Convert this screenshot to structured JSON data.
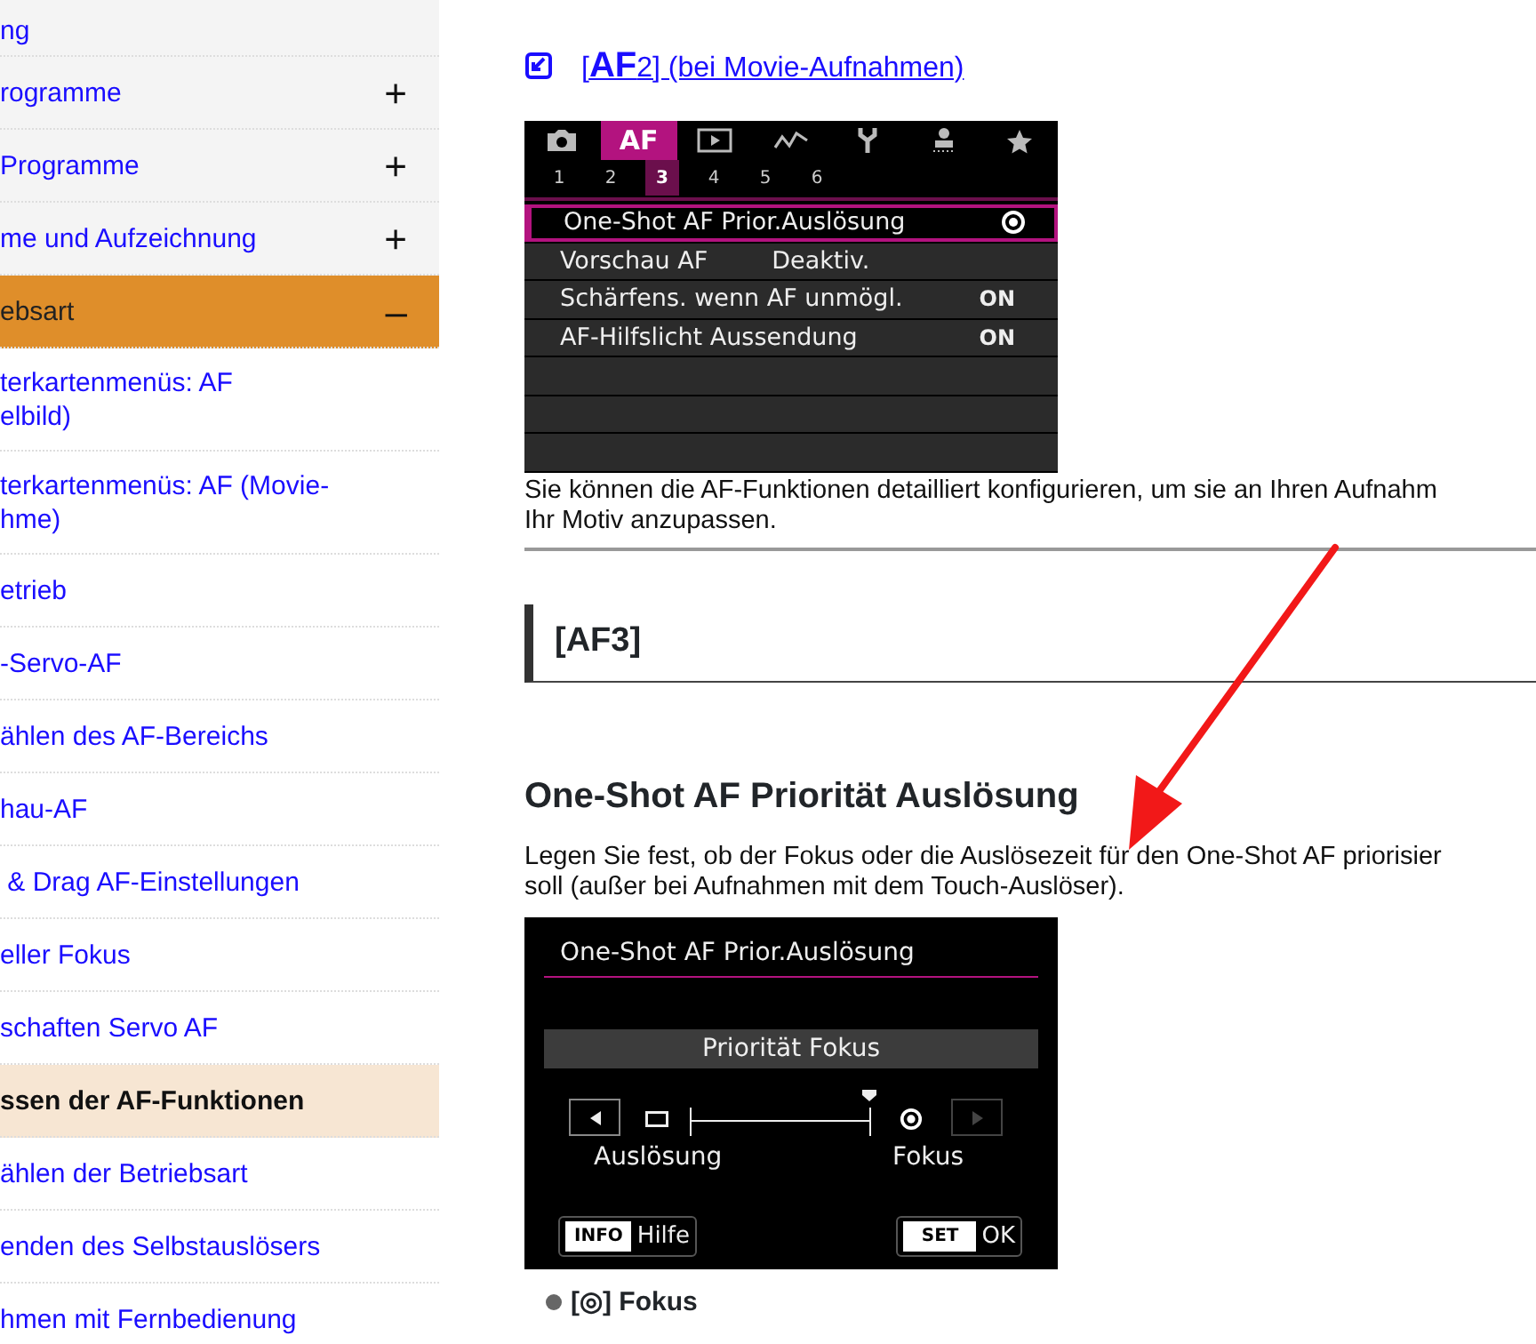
{
  "sidebar": {
    "items": [
      {
        "kind": "section",
        "label": "ng",
        "expanded": false
      },
      {
        "kind": "section",
        "label": "rogramme",
        "expanded": false,
        "toggle": "+"
      },
      {
        "kind": "section",
        "label": "Programme",
        "expanded": false,
        "toggle": "+"
      },
      {
        "kind": "section",
        "label": "me und Aufzeichnung",
        "expanded": false,
        "toggle": "+"
      },
      {
        "kind": "section",
        "label": "ebsart",
        "expanded": true,
        "toggle": "–"
      },
      {
        "kind": "page",
        "label": "terkartenmenüs: AF\nelbild)",
        "selected": false
      },
      {
        "kind": "page",
        "label": "terkartenmenüs: AF (Movie-\nhme)",
        "selected": false
      },
      {
        "kind": "page",
        "label": "etrieb",
        "selected": false
      },
      {
        "kind": "page",
        "label": "-Servo-AF",
        "selected": false
      },
      {
        "kind": "page",
        "label": "ählen des AF-Bereichs",
        "selected": false
      },
      {
        "kind": "page",
        "label": "hau-AF",
        "selected": false
      },
      {
        "kind": "page",
        "label": " & Drag AF-Einstellungen",
        "selected": false
      },
      {
        "kind": "page",
        "label": "eller Fokus",
        "selected": false
      },
      {
        "kind": "page",
        "label": "schaften Servo AF",
        "selected": false
      },
      {
        "kind": "page",
        "label": "ssen der AF-Funktionen",
        "selected": true
      },
      {
        "kind": "page",
        "label": "ählen der Betriebsart",
        "selected": false
      },
      {
        "kind": "page",
        "label": "enden des Selbstauslösers",
        "selected": false
      },
      {
        "kind": "page",
        "label": "hmen mit Fernbedienung",
        "selected": false
      }
    ]
  },
  "content": {
    "af2_link": "[**AF**2] (bei Movie-Aufnahmen)",
    "menu_screen": {
      "tabs": [
        {
          "selected": false
        },
        {
          "label": "AF",
          "selected": true
        },
        {
          "selected": false
        },
        {
          "selected": false
        },
        {
          "selected": false
        },
        {
          "selected": false
        },
        {
          "selected": false
        }
      ],
      "pages": [
        {
          "label": "1",
          "selected": false
        },
        {
          "label": "2",
          "selected": false
        },
        {
          "label": "3",
          "selected": true
        },
        {
          "label": "4",
          "selected": false
        },
        {
          "label": "5",
          "selected": false
        },
        {
          "label": "6",
          "selected": false
        }
      ],
      "rows": [
        {
          "label": "One-Shot AF Prior.Auslösung",
          "kind": "icon_value",
          "selected": true
        },
        {
          "label": "Vorschau AF",
          "kind": "text_value",
          "value": "Deaktiv.",
          "selected": false
        },
        {
          "label": "Schärfens. wenn AF unmögl.",
          "kind": "text_value",
          "value": "ON",
          "selected": false
        },
        {
          "label": "AF-Hilfslicht Aussendung",
          "kind": "text_value",
          "value": "ON",
          "selected": false
        }
      ]
    },
    "intro": [
      "Sie können die AF-Funktionen detailliert konfigurieren, um sie an Ihren Aufnahm",
      "Ihr Motiv anzupassen."
    ],
    "section_heading": "[AF3]",
    "heading": "One-Shot AF Priorität Auslösung",
    "description": [
      "Legen Sie fest, ob der Fokus oder die Auslösezeit für den One-Shot AF priorisier",
      "soll (außer bei Aufnahmen mit dem Touch-Auslöser)."
    ],
    "setting_screen": {
      "title": "One-Shot AF Prior.Auslösung",
      "value": "Priorität Fokus",
      "slider": {
        "level": 1,
        "left_label": "Auslösung",
        "right_label": "Fokus",
        "right_disabled": true
      },
      "info_key": "INFO",
      "info_label": "Hilfe",
      "set_key": "SET",
      "set_label": "OK"
    },
    "bullet": "[◎] Fokus"
  }
}
